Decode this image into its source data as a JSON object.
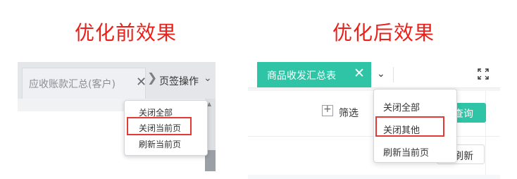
{
  "before_title": "优化前效果",
  "after_title": "优化后效果",
  "before": {
    "tab_label": "应收账款汇总(客户)",
    "tab_ops_label": "页签操作",
    "menu": [
      "关闭全部",
      "关闭当前页",
      "刷新当前页"
    ],
    "highlighted_index": 1
  },
  "after": {
    "tab_label": "商品收发汇总表",
    "filter_label": "筛选",
    "query_label": "查询",
    "refresh_label": "刷新",
    "menu": [
      "关闭全部",
      "关闭其他",
      "刷新当前页"
    ],
    "highlighted_index": 1
  },
  "colors": {
    "heading": "#e8211b",
    "accent_teal": "#2ec4a5",
    "highlight_border": "#e53935"
  },
  "icons": [
    "close-icon",
    "chevron-right-icon",
    "chevron-down-icon",
    "fullscreen-icon",
    "plus-square-icon"
  ]
}
